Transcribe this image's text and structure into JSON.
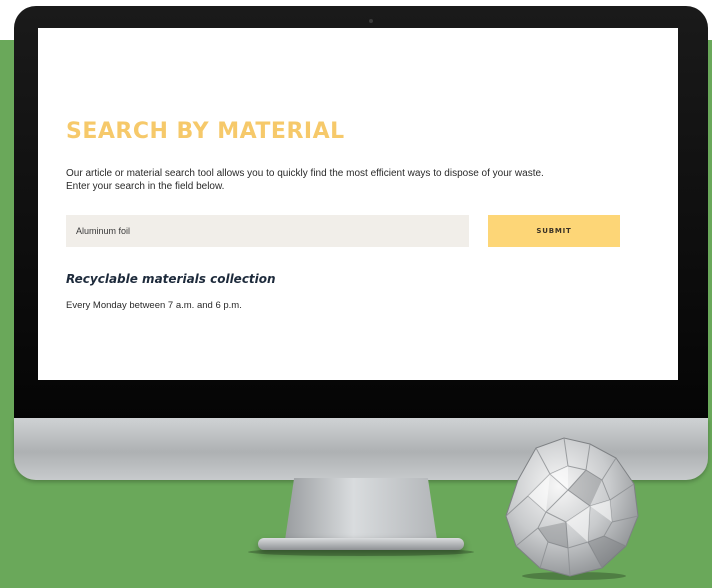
{
  "search_page": {
    "title": "SEARCH BY MATERIAL",
    "intro_line_1": "Our article or material search tool allows you to quickly find the most efficient ways to dispose of your waste.",
    "intro_line_2": "Enter your search in the field below.",
    "search": {
      "value": "Aluminum foil",
      "submit_label": "SUBMIT"
    },
    "collection": {
      "heading": "Recyclable materials collection",
      "schedule": "Every Monday between 7 a.m. and 6 p.m."
    }
  },
  "colors": {
    "background_green": "#6aa85a",
    "title_yellow": "#f6c96a",
    "button_yellow": "#fdd677",
    "input_bg": "#f1eee9",
    "heading_navy": "#1d2a3b"
  },
  "icons": {
    "foil": "crumpled-aluminum-foil"
  }
}
